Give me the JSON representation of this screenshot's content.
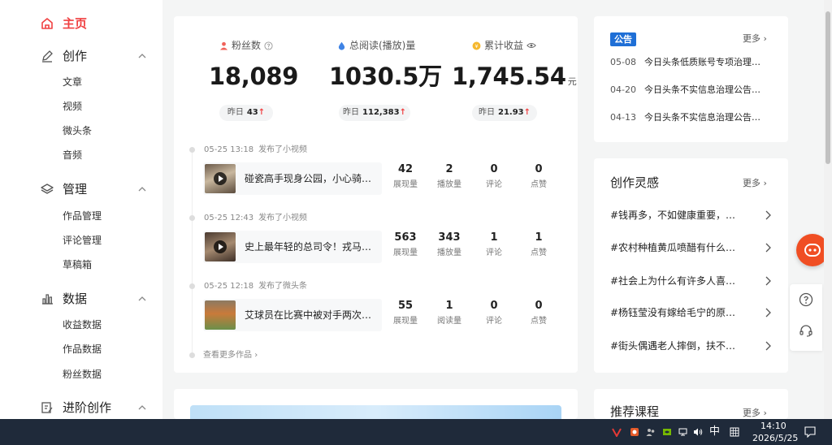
{
  "sidebar": {
    "home": "主页",
    "create": {
      "label": "创作",
      "items": [
        "文章",
        "视频",
        "微头条",
        "音频"
      ]
    },
    "manage": {
      "label": "管理",
      "items": [
        "作品管理",
        "评论管理",
        "草稿箱"
      ]
    },
    "data": {
      "label": "数据",
      "items": [
        "收益数据",
        "作品数据",
        "粉丝数据"
      ]
    },
    "advanced": {
      "label": "进阶创作"
    }
  },
  "stats": [
    {
      "label": "粉丝数",
      "value": "18,089",
      "unit": "",
      "yesterday_label": "昨日",
      "yesterday_value": "43"
    },
    {
      "label": "总阅读(播放)量",
      "value": "1030.5万",
      "unit": "",
      "yesterday_label": "昨日",
      "yesterday_value": "112,383"
    },
    {
      "label": "累计收益",
      "value": "1,745.54",
      "unit": "元",
      "yesterday_label": "昨日",
      "yesterday_value": "21.93"
    }
  ],
  "works": [
    {
      "time": "05-25 13:18",
      "action": "发布了小视频",
      "title": "碰瓷高手现身公园，小心骑…",
      "metrics": [
        {
          "value": "42",
          "label": "展现量"
        },
        {
          "value": "2",
          "label": "播放量"
        },
        {
          "value": "0",
          "label": "评论"
        },
        {
          "value": "0",
          "label": "点赞"
        }
      ]
    },
    {
      "time": "05-25 12:43",
      "action": "发布了小视频",
      "title": "史上最年轻的总司令！戎马…",
      "metrics": [
        {
          "value": "563",
          "label": "展现量"
        },
        {
          "value": "343",
          "label": "播放量"
        },
        {
          "value": "1",
          "label": "评论"
        },
        {
          "value": "1",
          "label": "点赞"
        }
      ]
    },
    {
      "time": "05-25 12:18",
      "action": "发布了微头条",
      "title": "艾球员在比赛中被对手两次…",
      "metrics": [
        {
          "value": "55",
          "label": "展现量"
        },
        {
          "value": "1",
          "label": "阅读量"
        },
        {
          "value": "0",
          "label": "评论"
        },
        {
          "value": "0",
          "label": "点赞"
        }
      ]
    }
  ],
  "more_works": "查看更多作品",
  "announcements": {
    "tag": "公告",
    "more": "更多",
    "items": [
      {
        "date": "05-08",
        "title": "今日头条低质账号专项治理…"
      },
      {
        "date": "04-20",
        "title": "今日头条不实信息治理公告…"
      },
      {
        "date": "04-13",
        "title": "今日头条不实信息治理公告…"
      }
    ]
  },
  "inspiration": {
    "title": "创作灵感",
    "more": "更多",
    "items": [
      "#钱再多，不如健康重要，…",
      "#农村种植黄瓜喷醋有什么…",
      "#社会上为什么有许多人喜…",
      "#杨钰莹没有嫁给毛宁的原…",
      "#街头偶遇老人摔倒，扶不…"
    ]
  },
  "courses": {
    "title": "推荐课程",
    "more": "更多"
  },
  "taskbar": {
    "ime": "中",
    "time": "14:10",
    "date": "2026/5/25"
  },
  "colors": {
    "accent": "#f04142",
    "brand_blue": "#1f6fd6",
    "fab": "#f04e23",
    "taskbar": "#1f2a3a"
  }
}
